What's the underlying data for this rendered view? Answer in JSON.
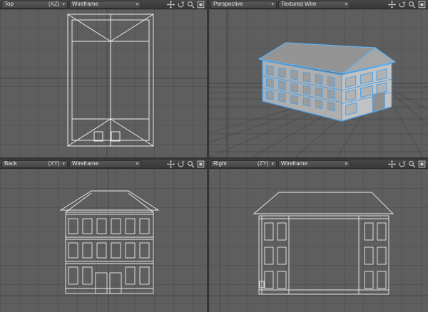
{
  "ui": {
    "caret": "▾"
  },
  "colors": {
    "viewport_background": "#5e5e5e",
    "header_background": "#3f3f3f",
    "wireframe_line": "#ececec",
    "selection_blue": "#4da1e8"
  },
  "viewports": {
    "top": {
      "name": "Top",
      "axis": "(XZ)",
      "shading": "Wireframe"
    },
    "perspective": {
      "name": "Perspective",
      "axis": "",
      "shading": "Textured Wire"
    },
    "back": {
      "name": "Back",
      "axis": "(XY)",
      "shading": "Wireframe"
    },
    "right": {
      "name": "Right",
      "axis": "(ZY)",
      "shading": "Wireframe"
    }
  },
  "header_icons": [
    "pan-icon",
    "rotate-icon",
    "zoom-icon",
    "maximize-icon"
  ]
}
